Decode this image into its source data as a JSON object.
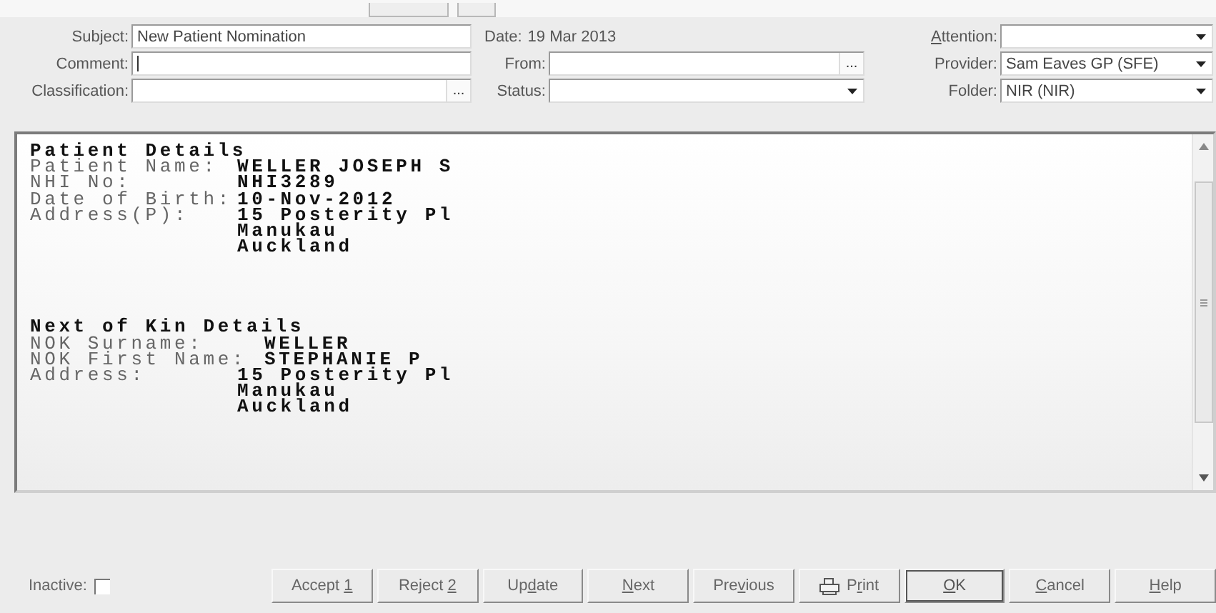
{
  "form_rows": [
    [
      {
        "kind": "text",
        "label": "Subject:",
        "value": "New Patient Nomination"
      },
      {
        "kind": "static",
        "label": "Date:",
        "value": "19 Mar 2013"
      },
      {
        "kind": "dropdown",
        "label_parts": {
          "key": "A",
          "post": "ttention:"
        }
      }
    ],
    [
      {
        "kind": "text",
        "label": "Comment:",
        "caret": true
      },
      {
        "kind": "ellipsis",
        "label": "From:",
        "button": "..."
      },
      {
        "kind": "dropdown",
        "label": "Provider:",
        "value": "Sam Eaves GP (SFE)"
      }
    ],
    [
      {
        "kind": "ellipsis",
        "label": "Classification:",
        "button": "..."
      },
      {
        "kind": "dropdown",
        "label": "Status:"
      },
      {
        "kind": "dropdown",
        "label": "Folder:",
        "value": "NIR (NIR)"
      }
    ]
  ],
  "document": [
    {
      "heading": "Patient Details",
      "rows": [
        {
          "label": "Patient Name:",
          "lines": [
            "WELLER JOSEPH S"
          ],
          "offset": false
        },
        {
          "label": "NHI No:",
          "lines": [
            "NHI3289"
          ],
          "offset": false
        },
        {
          "label": "Date of Birth:",
          "lines": [
            "10-Nov-2012"
          ],
          "offset": false
        },
        {
          "label": "Address(P):",
          "lines": [
            "15 Posterity Pl",
            "Manukau",
            "Auckland"
          ],
          "offset": false
        }
      ]
    },
    {
      "heading": "Next of Kin Details",
      "rows": [
        {
          "label": "NOK Surname:",
          "lines": [
            "WELLER"
          ],
          "offset": true
        },
        {
          "label": "NOK First Name:",
          "lines": [
            "STEPHANIE P"
          ],
          "offset": true
        },
        {
          "label": "Address:",
          "lines": [
            "15 Posterity Pl",
            "Manukau",
            "Auckland"
          ],
          "offset": false
        }
      ]
    }
  ],
  "inactive": {
    "label": "Inactive:",
    "checked": false
  },
  "buttons": [
    {
      "label_parts": {
        "pre": "Accept ",
        "key": "1"
      },
      "default": false,
      "kind": "plain"
    },
    {
      "label_parts": {
        "pre": "Reject ",
        "key": "2"
      },
      "default": false,
      "kind": "plain"
    },
    {
      "label_parts": {
        "pre": "Up",
        "key": "d",
        "post": "ate"
      },
      "default": false,
      "kind": "plain"
    },
    {
      "label_parts": {
        "key": "N",
        "post": "ext"
      },
      "default": false,
      "kind": "plain"
    },
    {
      "label_parts": {
        "pre": "Pre",
        "key": "v",
        "post": "ious"
      },
      "default": false,
      "kind": "plain"
    },
    {
      "label_parts": {
        "pre": "P",
        "key": "r",
        "post": "int"
      },
      "default": false,
      "kind": "print"
    },
    {
      "label_parts": {
        "key": "O",
        "post": "K"
      },
      "default": true,
      "kind": "plain"
    },
    {
      "label_parts": {
        "key": "C",
        "post": "ancel"
      },
      "default": false,
      "kind": "plain"
    },
    {
      "label_parts": {
        "key": "H",
        "post": "elp"
      },
      "default": false,
      "kind": "plain"
    }
  ]
}
